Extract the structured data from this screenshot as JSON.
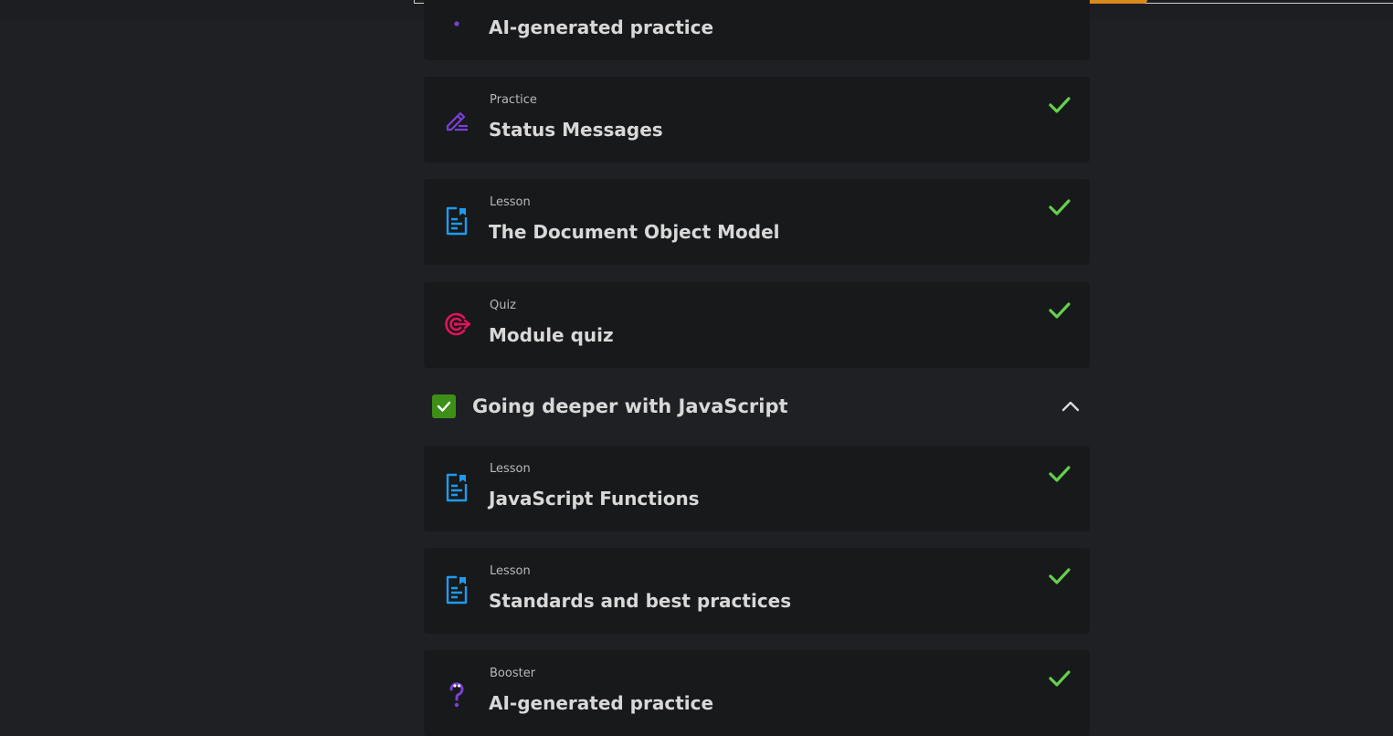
{
  "colors": {
    "background": "#1f2023",
    "card": "#18191b",
    "check_green": "#64d04d",
    "lesson_blue": "#1d9bf0",
    "practice_purple": "#7b3fd6",
    "quiz_pink": "#e0145a",
    "section_checkbox": "#3d8f17",
    "topbar_accent": "#d98a1c"
  },
  "top_partial_card": {
    "title": "AI-generated practice",
    "icon": "question-mark-icon"
  },
  "cards_group1": [
    {
      "type": "Practice",
      "title": "Status Messages",
      "icon": "pencil-icon",
      "completed": true
    },
    {
      "type": "Lesson",
      "title": "The Document Object Model",
      "icon": "document-icon",
      "completed": true
    },
    {
      "type": "Quiz",
      "title": "Module quiz",
      "icon": "target-icon",
      "completed": true
    }
  ],
  "section": {
    "title": "Going deeper with JavaScript",
    "completed": true,
    "expanded": true
  },
  "cards_group2": [
    {
      "type": "Lesson",
      "title": "JavaScript Functions",
      "icon": "document-icon",
      "completed": true
    },
    {
      "type": "Lesson",
      "title": "Standards and best practices",
      "icon": "document-icon",
      "completed": true
    },
    {
      "type": "Booster",
      "title": "AI-generated practice",
      "icon": "question-mark-icon",
      "completed": true
    }
  ]
}
